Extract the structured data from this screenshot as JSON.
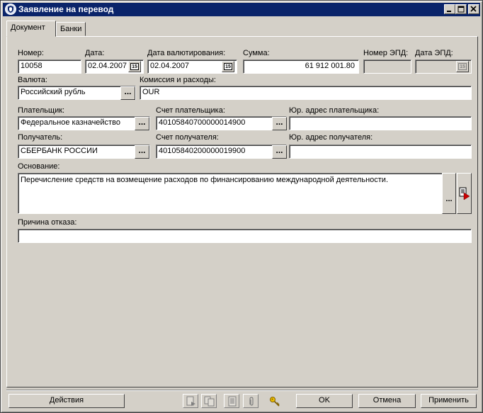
{
  "window": {
    "title": "Заявление на перевод"
  },
  "tabs": [
    {
      "label": "Документ",
      "active": true
    },
    {
      "label": "Банки",
      "active": false
    }
  ],
  "form": {
    "number": {
      "label": "Номер:",
      "value": "10058"
    },
    "date": {
      "label": "Дата:",
      "value": "02.04.2007"
    },
    "value_date": {
      "label": "Дата валютирования:",
      "value": "02.04.2007"
    },
    "amount": {
      "label": "Сумма:",
      "value": "61 912 001.80"
    },
    "epd_number": {
      "label": "Номер ЭПД:",
      "value": ""
    },
    "epd_date": {
      "label": "Дата ЭПД:",
      "value": ""
    },
    "currency": {
      "label": "Валюта:",
      "value": "Российский рубль"
    },
    "commission": {
      "label": "Комиссия и расходы:",
      "value": "OUR"
    },
    "payer": {
      "label": "Плательщик:",
      "value": "Федеральное казначейство"
    },
    "payer_account": {
      "label": "Счет плательщика:",
      "value": "40105840700000014900"
    },
    "payer_address": {
      "label": "Юр. адрес плательщика:",
      "value": ""
    },
    "recipient": {
      "label": "Получатель:",
      "value": "СБЕРБАНК РОССИИ"
    },
    "recipient_account": {
      "label": "Счет получателя:",
      "value": "40105840200000019900"
    },
    "recipient_address": {
      "label": "Юр. адрес получателя:",
      "value": ""
    },
    "basis": {
      "label": "Основание:",
      "value": "Перечисление средств на возмещение расходов по финансированию международной деятельности."
    },
    "rejection_reason": {
      "label": "Причина отказа:",
      "value": ""
    }
  },
  "common": {
    "ellipsis": "...",
    "calendar_day": "15"
  },
  "footer": {
    "actions_label": "Действия",
    "ok_label": "OK",
    "cancel_label": "Отмена",
    "apply_label": "Применить"
  },
  "colors": {
    "titlebar": "#0a246a",
    "face": "#d4d0c8",
    "accent_red": "#cc0000"
  }
}
